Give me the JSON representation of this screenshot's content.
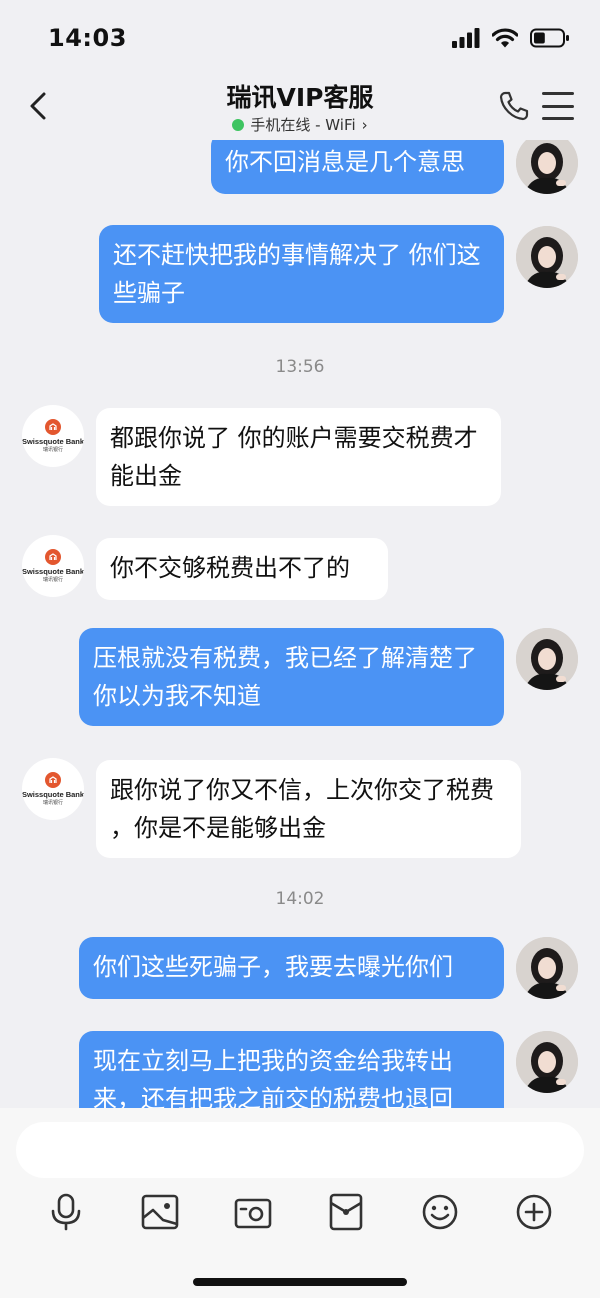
{
  "status_bar": {
    "time": "14:03",
    "battery_level": 0.4
  },
  "header": {
    "title": "瑞讯VIP客服",
    "status": "手机在线 - WiFi",
    "status_color": "#3ec461"
  },
  "contact": {
    "logo_name": "Swissquote Bank",
    "logo_sub": "瑞讯银行",
    "logo_color": "#e3572f"
  },
  "messages": [
    {
      "side": "me",
      "text": "你不回消息是几个意思"
    },
    {
      "side": "me",
      "text": "还不赶快把我的事情解决了 你们这些骗子"
    },
    {
      "time": "13:56"
    },
    {
      "side": "them",
      "text": "都跟你说了 你的账户需要交税费才能出金"
    },
    {
      "side": "them",
      "text": "你不交够税费出不了的"
    },
    {
      "side": "me",
      "text": "压根就没有税费，我已经了解清楚了你以为我不知道"
    },
    {
      "side": "them",
      "text": "跟你说了你又不信，上次你交了税费 ，你是不是能够出金"
    },
    {
      "time": "14:02"
    },
    {
      "side": "me",
      "text": "你们这些死骗子，我要去曝光你们"
    },
    {
      "side": "me",
      "text": "现在立刻马上把我的资金给我转出来，还有把我之前交的税费也退回"
    }
  ],
  "input": {
    "placeholder": ""
  },
  "toolbar": [
    "microphone-icon",
    "image-icon",
    "camera-icon",
    "red-packet-icon",
    "emoji-icon",
    "plus-icon"
  ],
  "colors": {
    "my_bubble": "#4b93f4",
    "their_bubble": "#ffffff",
    "background": "#f0f0f3"
  }
}
